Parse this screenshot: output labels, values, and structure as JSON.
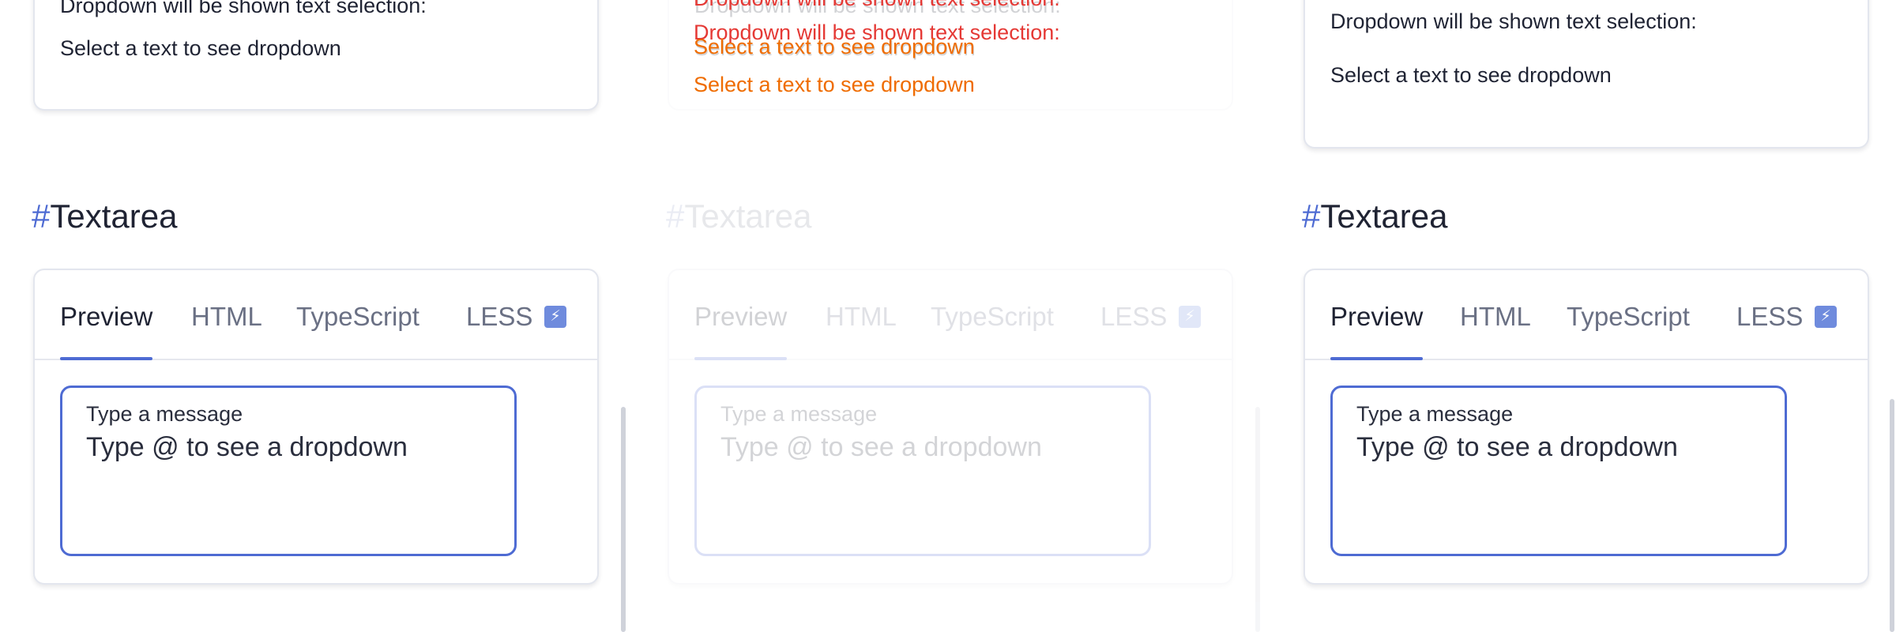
{
  "colors": {
    "accent": "#4e6bd3",
    "overlay_text": "#ef6c00",
    "overlay_text_alt": "#e53935"
  },
  "left": {
    "selection": {
      "dropdown_hint": "Dropdown will be shown text selection:",
      "select_prompt": "Select a text to see dropdown"
    },
    "section": {
      "hash": "#",
      "title": "Textarea"
    },
    "tabs": [
      "Preview",
      "HTML",
      "TypeScript",
      "LESS"
    ],
    "bolt_icon": "lightning-bolt-icon",
    "textarea": {
      "label": "Type a message",
      "value": "Type @ to see a dropdown"
    }
  },
  "middle": {
    "selection": {
      "dropdown_hint": "Dropdown will be shown text selection:",
      "select_prompt": "Select a text to see dropdown"
    },
    "section": {
      "hash": "#",
      "title": "Textarea"
    },
    "tabs": [
      "Preview",
      "HTML",
      "TypeScript",
      "LESS"
    ],
    "textarea": {
      "label": "Type a message",
      "value": "Type @ to see a dropdown"
    },
    "overlay": {
      "line1": "Dropdown will be shown text selection:",
      "line2": "Dropdown will be shown text selection:",
      "line3": "Select a text to see dropdown",
      "line4": "Select a text to see dropdown"
    }
  },
  "right": {
    "selection": {
      "dropdown_hint": "Dropdown will be shown text selection:",
      "select_prompt": "Select a text to see dropdown"
    },
    "section": {
      "hash": "#",
      "title": "Textarea"
    },
    "tabs": [
      "Preview",
      "HTML",
      "TypeScript",
      "LESS"
    ],
    "bolt_icon": "lightning-bolt-icon",
    "textarea": {
      "label": "Type a message",
      "value": "Type @ to see a dropdown"
    }
  }
}
